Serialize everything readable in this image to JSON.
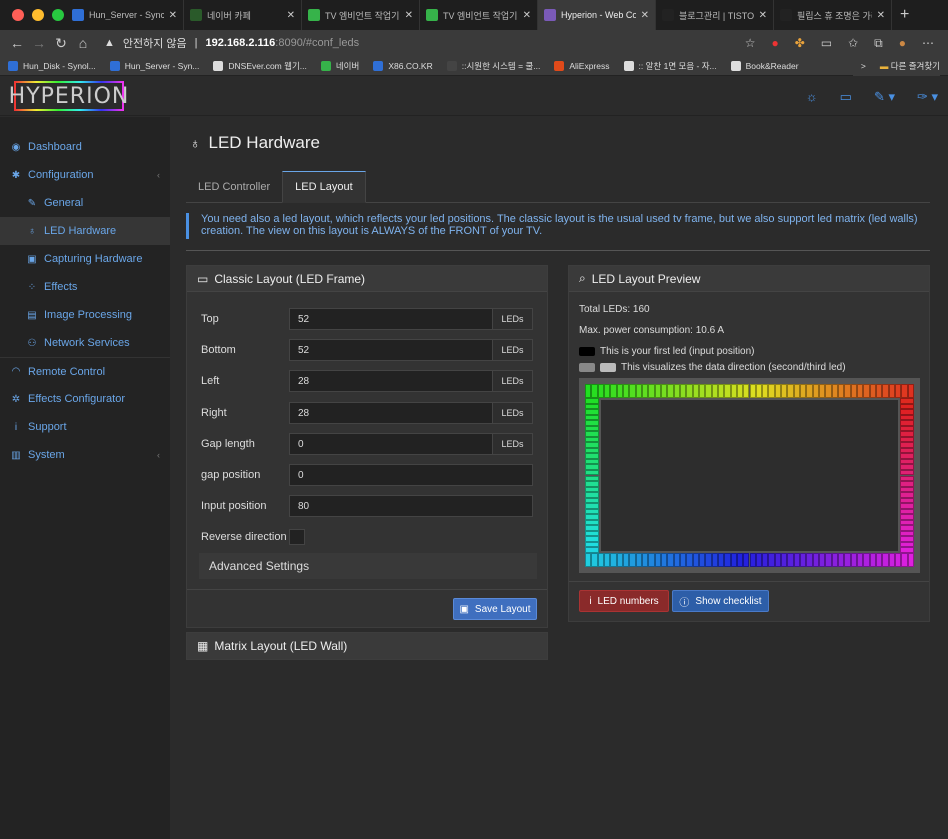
{
  "browser": {
    "tabs": [
      {
        "title": "Hun_Server - Sync",
        "favicon_color": "#2f6fd6",
        "active": false
      },
      {
        "title": "네이버 카페",
        "favicon_color": "#2a5a2a",
        "active": false
      },
      {
        "title": "TV 엠비언트 작업기 1(",
        "favicon_color": "#36b34a",
        "active": false
      },
      {
        "title": "TV 엠비언트 작업기 1(",
        "favicon_color": "#36b34a",
        "active": false
      },
      {
        "title": "Hyperion - Web Co",
        "favicon_color": "#7a5ab8",
        "active": true
      },
      {
        "title": "블로그관리 | TISTOR",
        "favicon_color": "#222222",
        "active": false
      },
      {
        "title": "필립스 휴 조명은 가리",
        "favicon_color": "#222222",
        "active": false
      }
    ],
    "new_tab": "+",
    "security_label": "안전하지 않음",
    "url_host": "192.168.2.116",
    "url_rest": ":8090/#conf_leds",
    "bookmarks": [
      {
        "label": "Hun_Disk - Synol...",
        "color": "#2f6fd6"
      },
      {
        "label": "Hun_Server - Syn...",
        "color": "#2f6fd6"
      },
      {
        "label": "DNSEver.com 웹기...",
        "color": "#dddddd"
      },
      {
        "label": "네이버",
        "color": "#36b34a"
      },
      {
        "label": "X86.CO.KR",
        "color": "#2f6fd6"
      },
      {
        "label": "::시원한 시스템 = 쿨...",
        "color": "#444444"
      },
      {
        "label": "AliExpress",
        "color": "#e04a1a"
      },
      {
        "label": ":: 알찬 1면 모음 - 자...",
        "color": "#dddddd"
      },
      {
        "label": "Book&Reader",
        "color": "#dddddd"
      }
    ],
    "bookmarks_more": ">",
    "other_bookmarks": "다른 즐겨찾기"
  },
  "app": {
    "logo": "HYPERION"
  },
  "sidebar": {
    "items": [
      {
        "label": "Dashboard",
        "icon": "dashboard-icon",
        "glyph": "◉",
        "sub": false,
        "selected": false,
        "chevron": false
      },
      {
        "label": "Configuration",
        "icon": "gear-icon",
        "glyph": "✱",
        "sub": false,
        "selected": false,
        "chevron": true
      },
      {
        "label": "General",
        "icon": "wrench-icon",
        "glyph": "✎",
        "sub": true,
        "selected": false,
        "chevron": false
      },
      {
        "label": "LED Hardware",
        "icon": "lightbulb-icon",
        "glyph": "♁",
        "sub": true,
        "selected": true,
        "chevron": false
      },
      {
        "label": "Capturing Hardware",
        "icon": "camera-icon",
        "glyph": "▣",
        "sub": true,
        "selected": false,
        "chevron": false
      },
      {
        "label": "Effects",
        "icon": "spinner-icon",
        "glyph": "⁘",
        "sub": true,
        "selected": false,
        "chevron": false
      },
      {
        "label": "Image Processing",
        "icon": "image-icon",
        "glyph": "▤",
        "sub": true,
        "selected": false,
        "chevron": false
      },
      {
        "label": "Network Services",
        "icon": "network-icon",
        "glyph": "⚇",
        "sub": true,
        "selected": false,
        "chevron": false
      },
      {
        "label": "Remote Control",
        "icon": "wifi-icon",
        "glyph": "◠",
        "sub": false,
        "selected": false,
        "chevron": false
      },
      {
        "label": "Effects Configurator",
        "icon": "gears-icon",
        "glyph": "✲",
        "sub": false,
        "selected": false,
        "chevron": false
      },
      {
        "label": "Support",
        "icon": "info-icon",
        "glyph": "i",
        "sub": false,
        "selected": false,
        "chevron": false
      },
      {
        "label": "System",
        "icon": "chart-icon",
        "glyph": "▥",
        "sub": false,
        "selected": false,
        "chevron": true
      }
    ]
  },
  "page": {
    "title": "LED Hardware",
    "tabs": [
      "LED Controller",
      "LED Layout"
    ],
    "info": "You need also a led layout, which reflects your led positions. The classic layout is the usual used tv frame, but we also support led matrix (led walls) creation. The view on this layout is ALWAYS of the FRONT of your TV."
  },
  "classic": {
    "title": "Classic Layout (LED Frame)",
    "fields": {
      "top": {
        "label": "Top",
        "value": "52",
        "unit": "LEDs"
      },
      "bottom": {
        "label": "Bottom",
        "value": "52",
        "unit": "LEDs"
      },
      "left": {
        "label": "Left",
        "value": "28",
        "unit": "LEDs"
      },
      "right": {
        "label": "Right",
        "value": "28",
        "unit": "LEDs"
      },
      "gap_length": {
        "label": "Gap length",
        "value": "0",
        "unit": "LEDs"
      },
      "gap_position": {
        "label": "gap position",
        "value": "0"
      },
      "input_position": {
        "label": "Input position",
        "value": "80"
      },
      "reverse": {
        "label": "Reverse direction",
        "checked": false
      }
    },
    "advanced": "Advanced Settings",
    "save": "Save Layout"
  },
  "matrix": {
    "title": "Matrix Layout (LED Wall)"
  },
  "preview": {
    "title": "LED Layout Preview",
    "total": "Total LEDs: 160",
    "power": "Max. power consumption: 10.6 A",
    "first_led": "This is your first led (input position)",
    "direction": "This visualizes the data direction (second/third led)",
    "btn_numbers": "LED numbers",
    "btn_checklist": "Show checklist"
  }
}
